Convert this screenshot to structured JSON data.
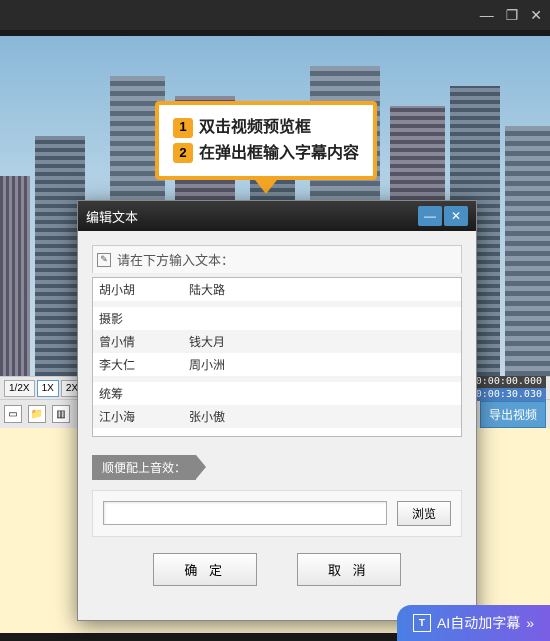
{
  "window": {
    "minimize": "—",
    "maximize": "❐",
    "close": "✕"
  },
  "callout": {
    "step1_num": "1",
    "step1_text": "双击视频预览框",
    "step2_num": "2",
    "step2_text": "在弹出框输入字幕内容"
  },
  "controls": {
    "speed_half": "1/2X",
    "speed_1x": "1X",
    "speed_2x": "2X",
    "time_current": "0:00:00.000",
    "time_total": "0:00:30.030"
  },
  "toolbar": {
    "export_label": "导出视频"
  },
  "modal": {
    "title": "编辑文本",
    "input_label": "请在下方输入文本：",
    "rows": [
      {
        "c1": "胡小胡",
        "c2": "陆大路"
      },
      {
        "c1": "",
        "c2": ""
      },
      {
        "c1": "摄影",
        "c2": ""
      },
      {
        "c1": "曾小倩",
        "c2": "钱大月"
      },
      {
        "c1": "李大仁",
        "c2": "周小洲"
      },
      {
        "c1": "",
        "c2": ""
      },
      {
        "c1": "统筹",
        "c2": ""
      },
      {
        "c1": "江小海",
        "c2": "张小傲"
      }
    ],
    "sound_label": "顺便配上音效：",
    "browse": "浏览",
    "ok": "确 定",
    "cancel": "取 消"
  },
  "ai_button": {
    "icon_text": "T",
    "label": "AI自动加字幕",
    "arrows": "»"
  }
}
